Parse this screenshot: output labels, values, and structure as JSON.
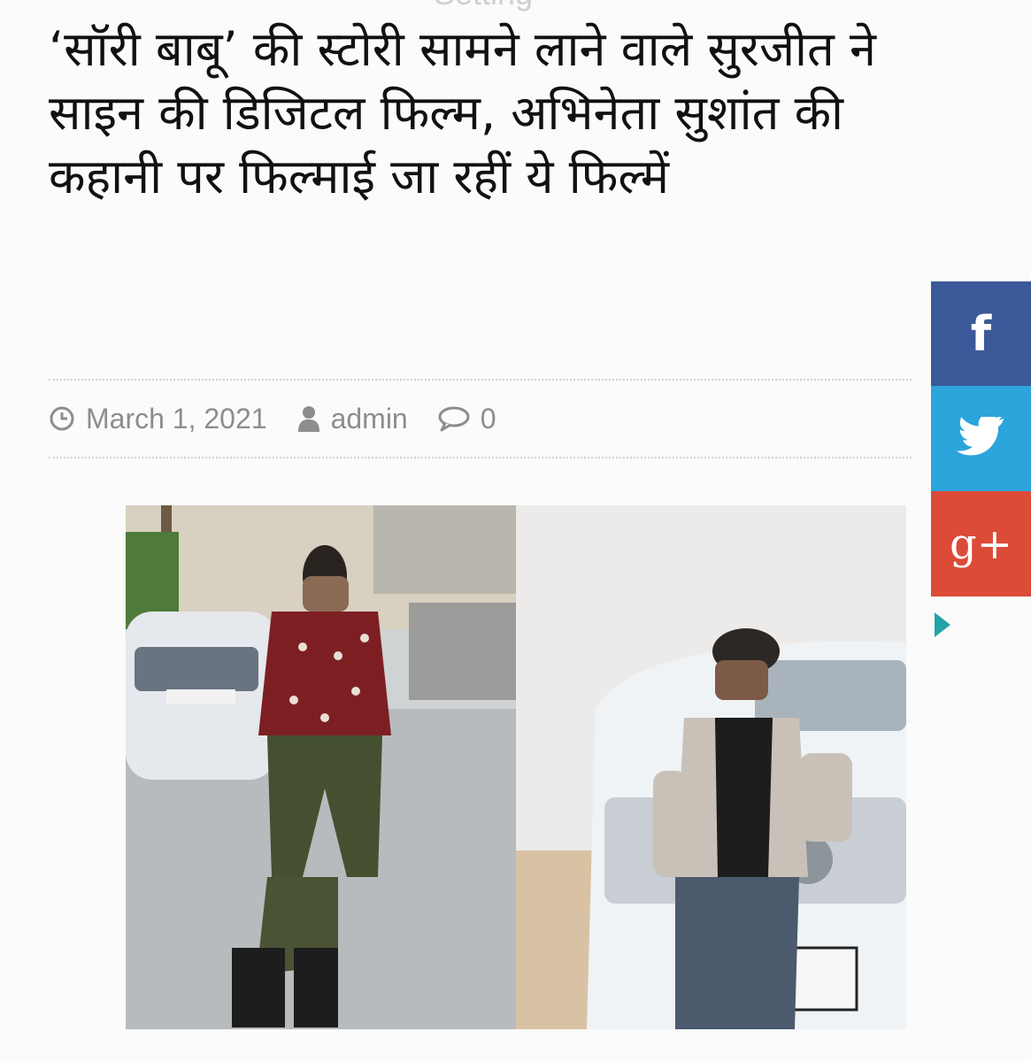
{
  "header": {
    "ghost_text": "Setting"
  },
  "article": {
    "title": "‘सॉरी बाबू’ की स्टोरी सामने लाने वाले सुरजीत ने साइन की डिजिटल फिल्म, अभिनेता सुशांत की कहानी पर फिल्माई जा रहीं ये फिल्में",
    "date": "March 1, 2021",
    "author": "admin",
    "comments": "0"
  },
  "share": {
    "facebook": {
      "glyph": "f",
      "color": "#3b5998"
    },
    "twitter": {
      "icon": "twitter-bird-icon",
      "color": "#2ca4dc"
    },
    "googleplus": {
      "glyph": "g+",
      "color": "#dc4a38"
    }
  },
  "icons": {
    "date": "clock-icon",
    "author": "user-icon",
    "comments": "comment-icon",
    "toggle": "triangle-right-icon"
  }
}
